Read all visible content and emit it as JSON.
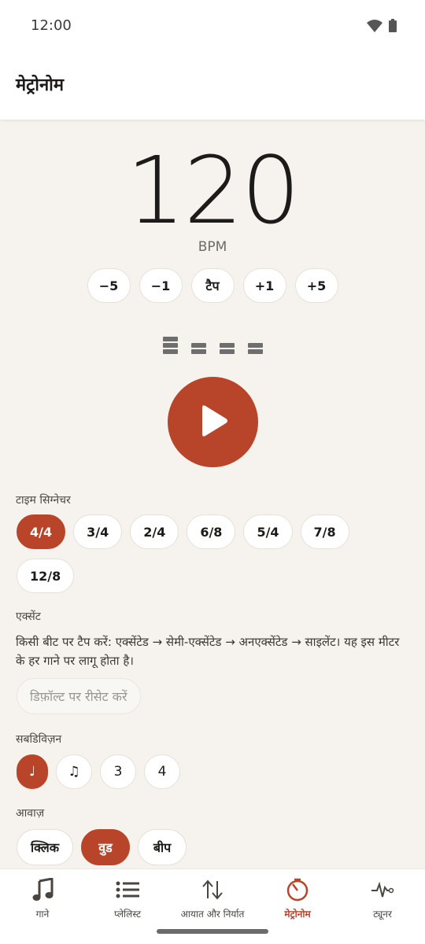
{
  "status_bar": {
    "time": "12:00",
    "icons": [
      "wifi-icon",
      "battery-icon"
    ]
  },
  "app_bar": {
    "title": "मेट्रोनोम"
  },
  "tempo": {
    "bpm": "120",
    "unit": "BPM",
    "adjust_buttons": [
      "−5",
      "−1",
      "टैप",
      "+1",
      "+5"
    ]
  },
  "beat_indicators": [
    {
      "level": "accented"
    },
    {
      "level": "semi-accented"
    },
    {
      "level": "semi-accented"
    },
    {
      "level": "semi-accented"
    }
  ],
  "play_button": {
    "icon": "play-icon"
  },
  "time_signature": {
    "label": "टाइम सिग्नेचर",
    "options": [
      "4/4",
      "3/4",
      "2/4",
      "6/8",
      "5/4",
      "7/8",
      "12/8"
    ],
    "selected": "4/4"
  },
  "accent": {
    "label": "एक्सेंट",
    "description": "किसी बीट पर टैप करें: एक्सेंटेड → सेमी-एक्सेंटेड → अनएक्सेंटेड → साइलेंट। यह इस मीटर के हर गाने पर लागू होता है।",
    "reset_label": "डिफ़ॉल्ट पर रीसेट करें"
  },
  "subdivision": {
    "label": "सबडिविज़न",
    "options": [
      "♩",
      "♫",
      "3",
      "4"
    ],
    "selected": "♩"
  },
  "sound": {
    "label": "आवाज़",
    "options": [
      "क्लिक",
      "वुड",
      "बीप"
    ],
    "selected": "वुड"
  },
  "bottom_nav": {
    "items": [
      {
        "label": "गाने",
        "icon": "music-note-icon"
      },
      {
        "label": "प्लेलिस्ट",
        "icon": "list-icon"
      },
      {
        "label": "आयात और निर्यात",
        "icon": "import-export-icon"
      },
      {
        "label": "मेट्रोनोम",
        "icon": "metronome-icon"
      },
      {
        "label": "ट्यूनर",
        "icon": "tuner-icon"
      }
    ],
    "active": "मेट्रोनोम"
  },
  "colors": {
    "accent": "#b8452a",
    "background": "#f6f3ee",
    "surface": "#ffffff"
  }
}
